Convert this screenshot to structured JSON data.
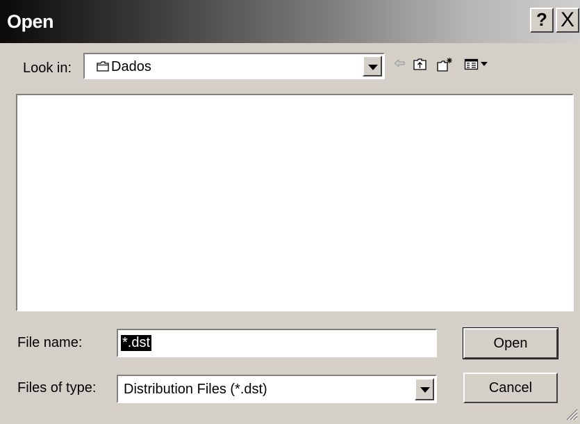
{
  "window": {
    "title": "Open"
  },
  "titlebar": {
    "help_label": "?",
    "close_label": "X"
  },
  "lookin": {
    "label": "Look in:",
    "value": "Dados"
  },
  "file_name": {
    "label": "File name:",
    "value": "*.dst"
  },
  "file_type": {
    "label": "Files of type:",
    "value": "Distribution Files (*.dst)"
  },
  "buttons": {
    "open_label": "Open",
    "cancel_label": "Cancel"
  },
  "icons": {
    "folder": "folder-icon",
    "back": "back-arrow-icon",
    "up": "up-folder-icon",
    "new_folder": "new-folder-icon",
    "view_menu": "view-menu-icon"
  },
  "colors": {
    "titlebar_start": "#0a0a0a",
    "titlebar_end": "#cfcfcf",
    "dialog_bg": "#d4d0c8"
  }
}
